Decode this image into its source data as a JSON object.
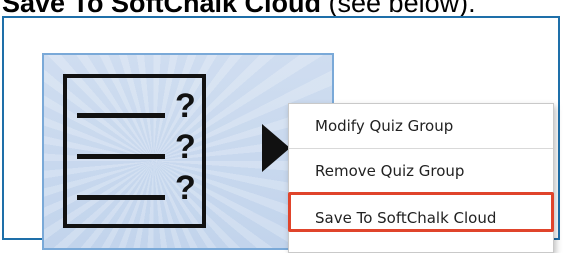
{
  "caption": {
    "bold": "Save To SoftChalk Cloud",
    "rest": " (see below)."
  },
  "quiz_icon": {
    "marks": [
      "?",
      "?",
      "?"
    ]
  },
  "context_menu": {
    "items": [
      {
        "label": "Modify Quiz Group"
      },
      {
        "label": "Remove Quiz Group"
      },
      {
        "label": "Save To SoftChalk Cloud"
      }
    ]
  },
  "colors": {
    "frame_border": "#1e6fa9",
    "tile_background": "#c8d8ee",
    "highlight": "#e0442b"
  },
  "icons": [
    "quiz-group-icon",
    "menu-arrow-icon"
  ]
}
